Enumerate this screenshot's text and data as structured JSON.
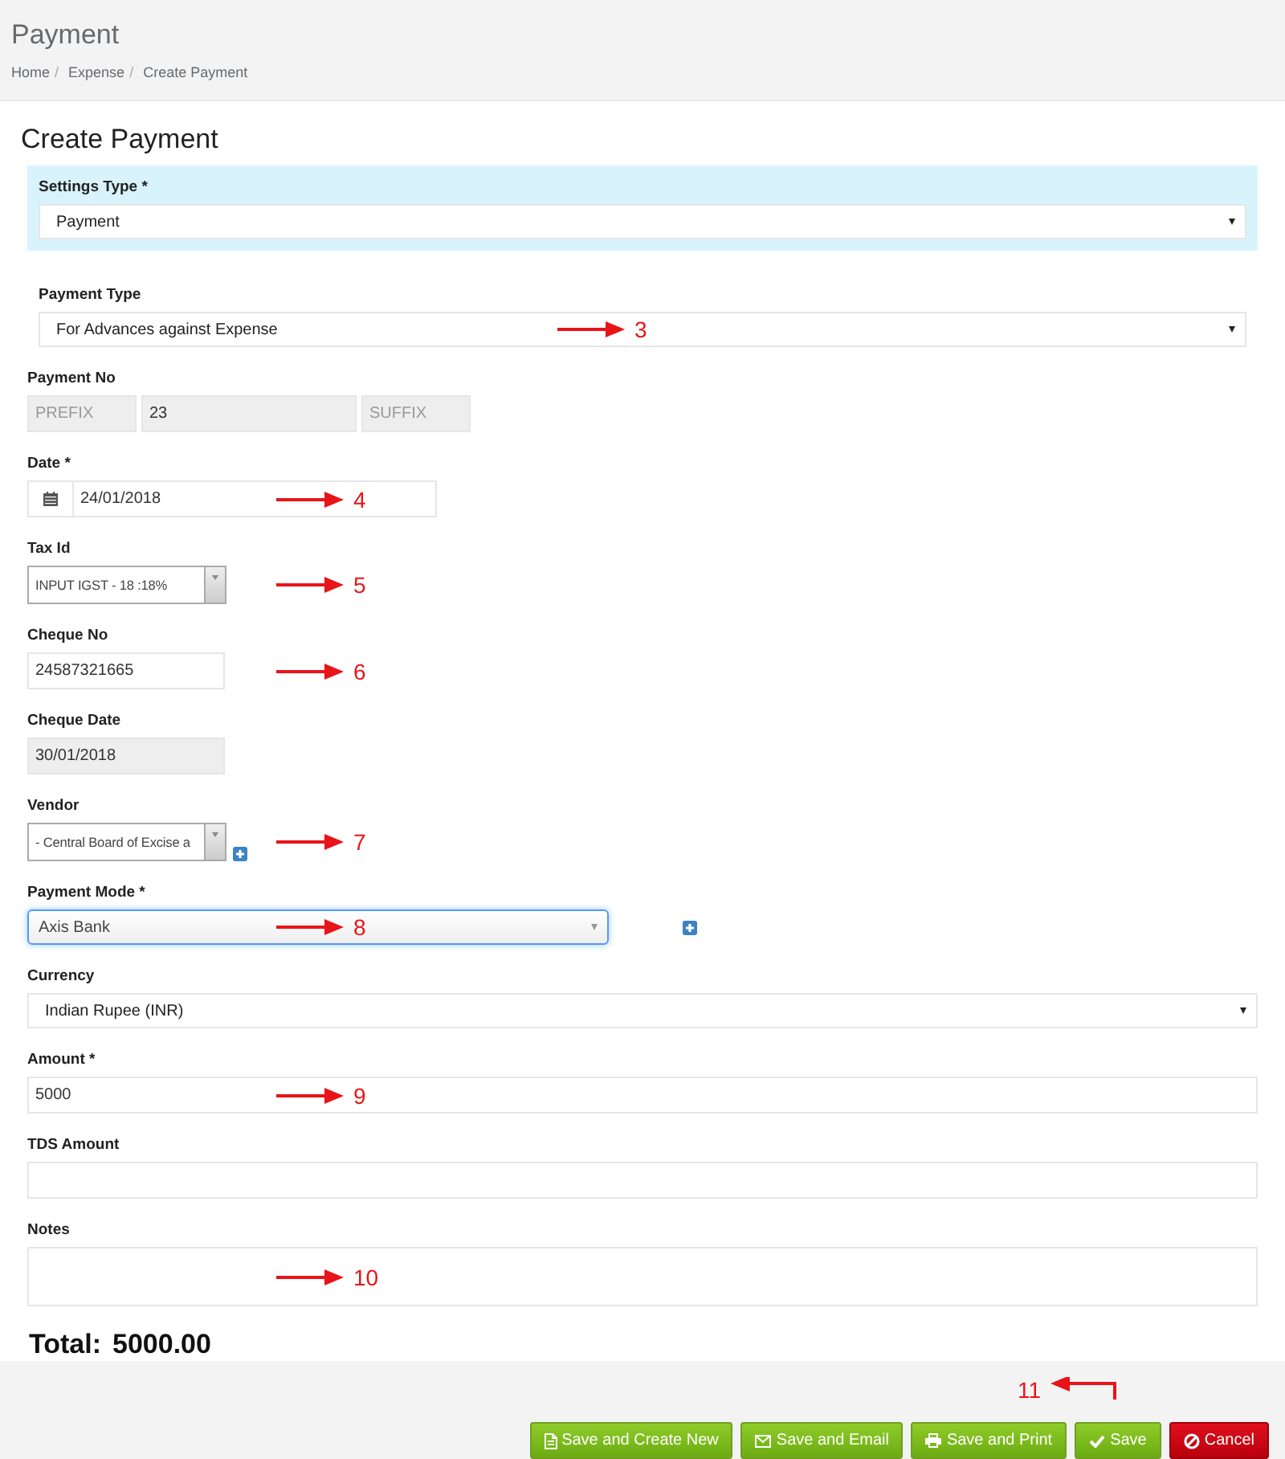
{
  "header": {
    "title": "Payment",
    "breadcrumb": [
      "Home",
      "Expense",
      "Create Payment"
    ],
    "separator": "/"
  },
  "form_title": "Create Payment",
  "settings_type": {
    "label": "Settings Type *",
    "value": "Payment"
  },
  "fields": [
    {
      "kind": "select",
      "label": "Payment Type",
      "value": "For Advances against Expense",
      "callout": "3"
    },
    {
      "kind": "triple",
      "label": "Payment No",
      "disabled": true,
      "parts": [
        {
          "placeholder": "PREFIX"
        },
        {
          "value": "23"
        },
        {
          "placeholder": "SUFFIX"
        }
      ]
    },
    {
      "kind": "date",
      "label": "Date *",
      "value": "24/01/2018",
      "callout": "4"
    },
    {
      "kind": "combo",
      "label": "Tax Id",
      "value": "INPUT IGST - 18 :18%",
      "callout": "5"
    },
    {
      "kind": "text",
      "label": "Cheque No",
      "value": "24587321665",
      "disabled": false,
      "callout": "6"
    },
    {
      "kind": "text",
      "label": "Cheque Date",
      "value": "30/01/2018",
      "disabled": true
    },
    {
      "kind": "combo",
      "label": "Vendor",
      "value": "- Central Board of Excise a",
      "add_button": true,
      "callout": "7"
    },
    {
      "kind": "picker",
      "label": "Payment Mode *",
      "value": "Axis Bank",
      "focused": true,
      "add_button": true,
      "callout": "8"
    },
    {
      "kind": "select",
      "label": "Currency",
      "value": "Indian Rupee (INR)"
    },
    {
      "kind": "text",
      "label": "Amount *",
      "value": "5000",
      "disabled": false,
      "callout": "9"
    },
    {
      "kind": "text",
      "label": "TDS Amount",
      "disabled": false
    },
    {
      "kind": "textarea",
      "label": "Notes",
      "callout": "10"
    }
  ],
  "total": {
    "label": "Total:",
    "value": "5000.00"
  },
  "footer_callout": "11",
  "buttons": [
    {
      "label": "Save and Create New",
      "kind": "create_new"
    },
    {
      "label": "Save and Email",
      "kind": "email"
    },
    {
      "label": "Save and Print",
      "kind": "print"
    },
    {
      "label": "Save",
      "kind": "save"
    },
    {
      "label": "Cancel",
      "kind": "cancel"
    }
  ]
}
